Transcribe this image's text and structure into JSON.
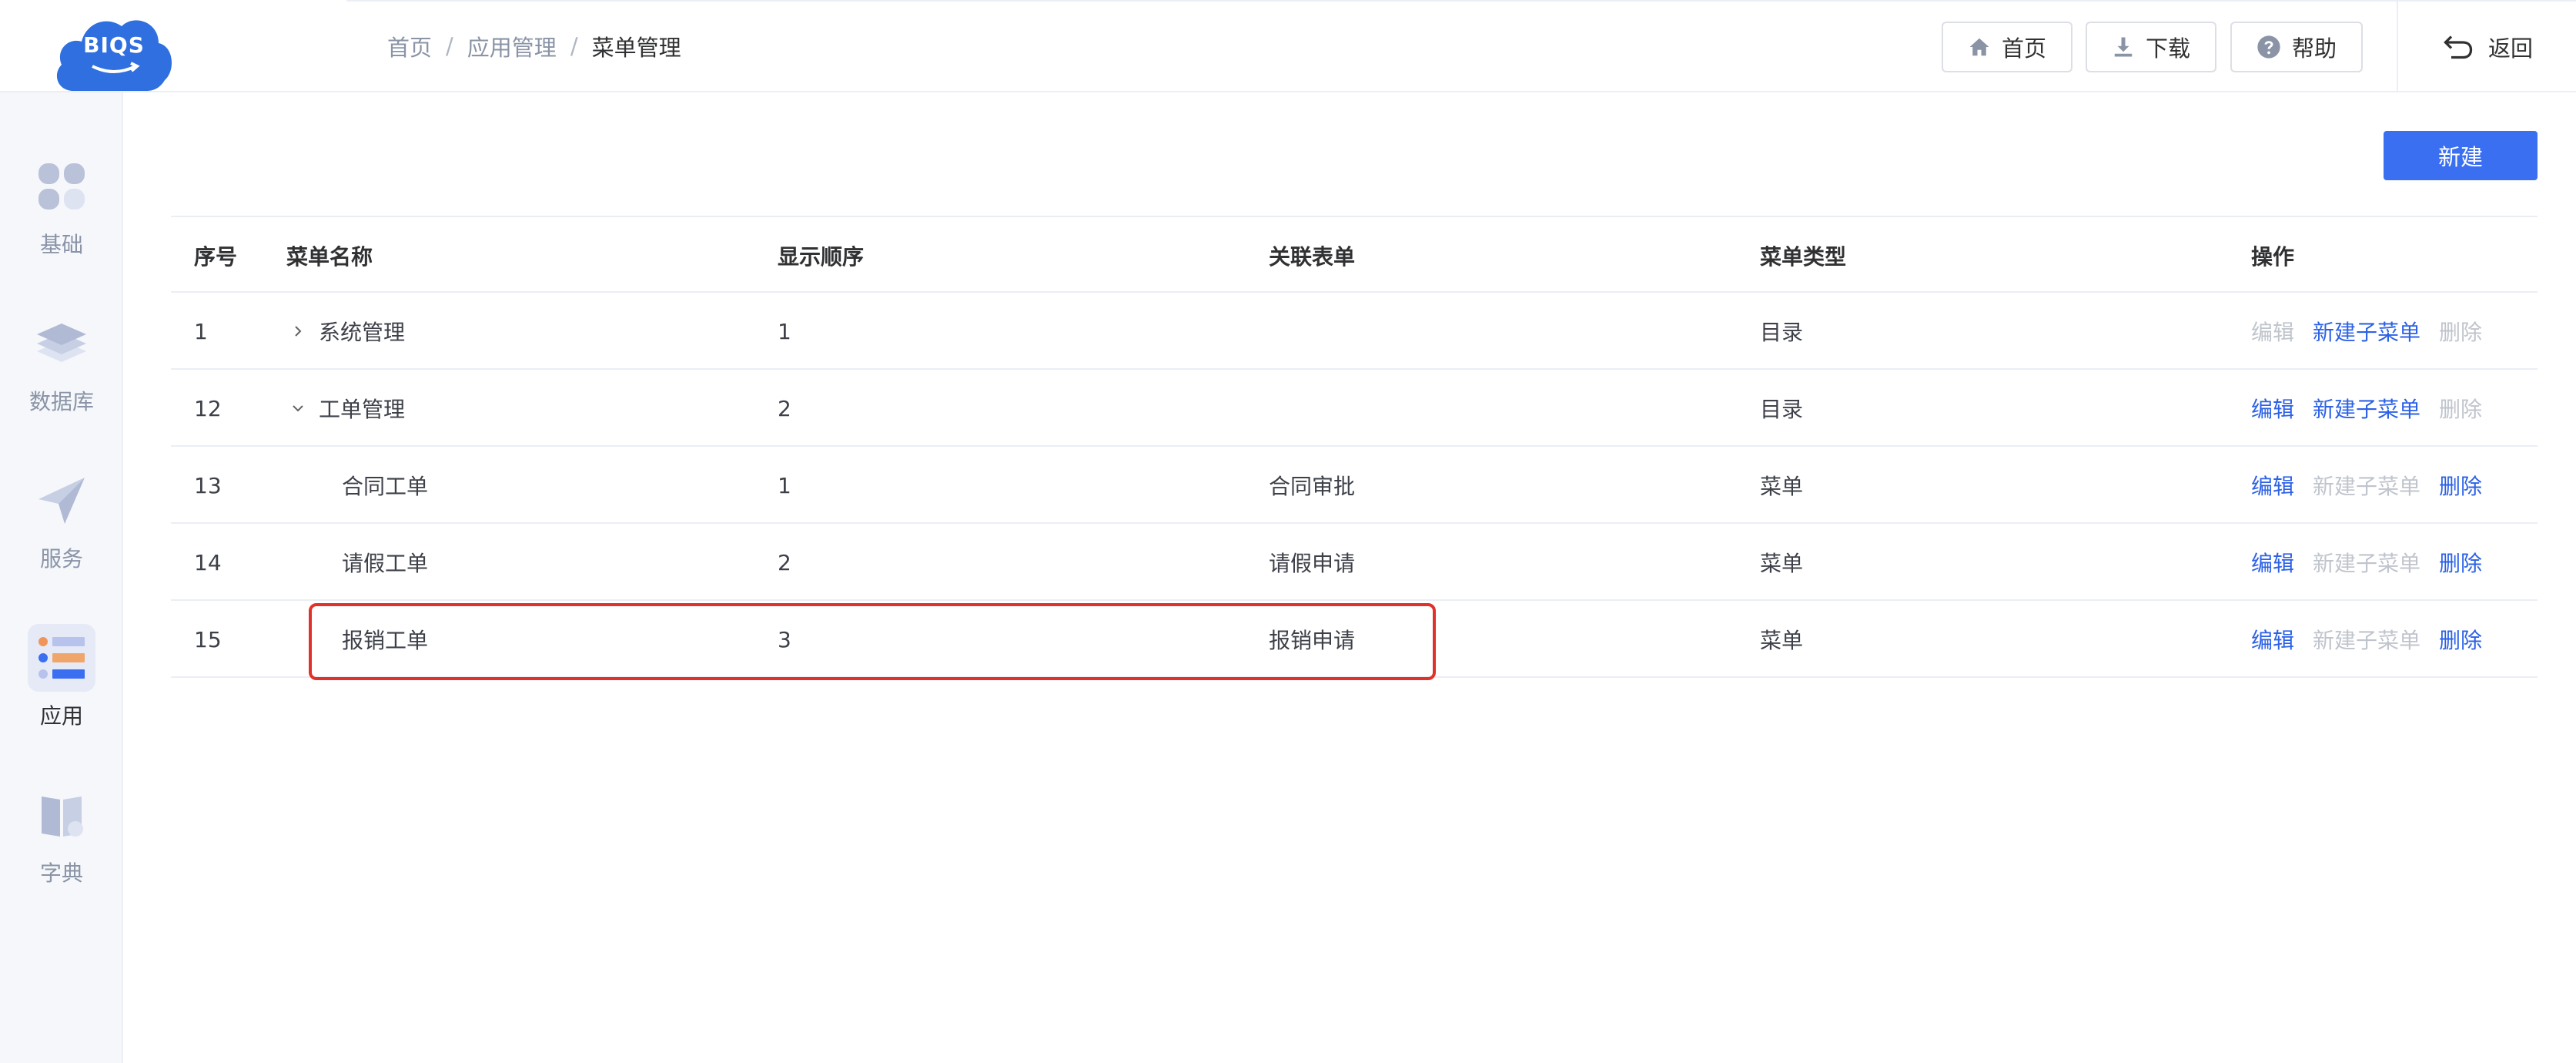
{
  "logo": {
    "text": "BIQS"
  },
  "breadcrumb": [
    {
      "label": "首页"
    },
    {
      "label": "应用管理"
    },
    {
      "label": "菜单管理"
    }
  ],
  "breadcrumb_sep": "/",
  "header": {
    "home_label": "首页",
    "download_label": "下载",
    "help_label": "帮助",
    "back_label": "返回"
  },
  "sidebar": {
    "items": [
      {
        "label": "基础",
        "icon": "grid-icon"
      },
      {
        "label": "数据库",
        "icon": "layers-icon"
      },
      {
        "label": "服务",
        "icon": "send-icon"
      },
      {
        "label": "应用",
        "icon": "app-list-icon",
        "active": true
      },
      {
        "label": "字典",
        "icon": "book-icon"
      }
    ]
  },
  "toolbar": {
    "new_label": "新建"
  },
  "table": {
    "columns": [
      "序号",
      "菜单名称",
      "显示顺序",
      "关联表单",
      "菜单类型",
      "操作"
    ],
    "rows": [
      {
        "idx": "1",
        "name": "系统管理",
        "order": "1",
        "form": "",
        "type": "目录",
        "expander": "collapsed",
        "ops": [
          {
            "label": "编辑",
            "enabled": false
          },
          {
            "label": "新建子菜单",
            "enabled": true
          },
          {
            "label": "删除",
            "enabled": false
          }
        ]
      },
      {
        "idx": "12",
        "name": "工单管理",
        "order": "2",
        "form": "",
        "type": "目录",
        "expander": "expanded",
        "ops": [
          {
            "label": "编辑",
            "enabled": true
          },
          {
            "label": "新建子菜单",
            "enabled": true
          },
          {
            "label": "删除",
            "enabled": false
          }
        ]
      },
      {
        "idx": "13",
        "name": "合同工单",
        "order": "1",
        "form": "合同审批",
        "type": "菜单",
        "expander": "none",
        "ops": [
          {
            "label": "编辑",
            "enabled": true
          },
          {
            "label": "新建子菜单",
            "enabled": false
          },
          {
            "label": "删除",
            "enabled": true
          }
        ]
      },
      {
        "idx": "14",
        "name": "请假工单",
        "order": "2",
        "form": "请假申请",
        "type": "菜单",
        "expander": "none",
        "ops": [
          {
            "label": "编辑",
            "enabled": true
          },
          {
            "label": "新建子菜单",
            "enabled": false
          },
          {
            "label": "删除",
            "enabled": true
          }
        ]
      },
      {
        "idx": "15",
        "name": "报销工单",
        "order": "3",
        "form": "报销申请",
        "type": "菜单",
        "expander": "none",
        "ops": [
          {
            "label": "编辑",
            "enabled": true
          },
          {
            "label": "新建子菜单",
            "enabled": false
          },
          {
            "label": "删除",
            "enabled": true
          }
        ]
      }
    ]
  },
  "colors": {
    "accent": "#3a6ff2",
    "link": "#2d62e6",
    "disabled": "#c0c4cc",
    "highlight": "#e0322b"
  }
}
